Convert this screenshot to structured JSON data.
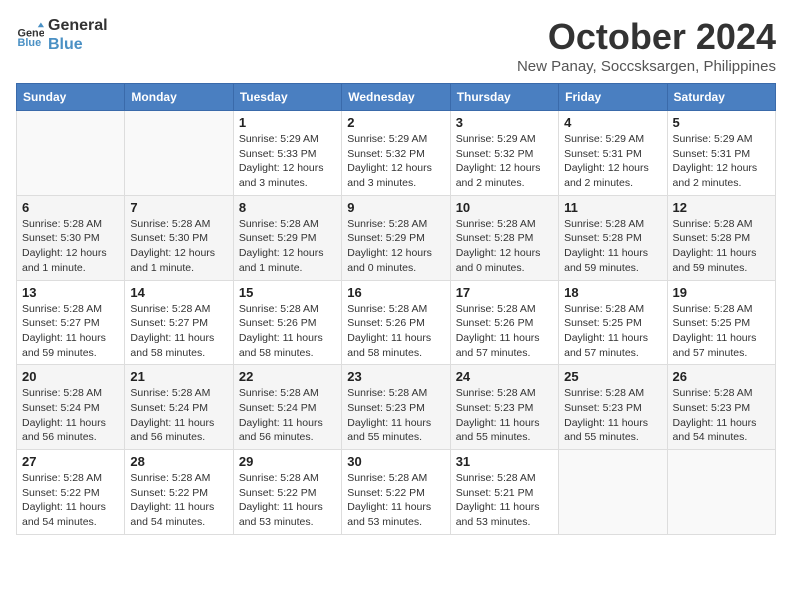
{
  "logo": {
    "line1": "General",
    "line2": "Blue"
  },
  "title": "October 2024",
  "subtitle": "New Panay, Soccsksargen, Philippines",
  "days_of_week": [
    "Sunday",
    "Monday",
    "Tuesday",
    "Wednesday",
    "Thursday",
    "Friday",
    "Saturday"
  ],
  "weeks": [
    [
      {
        "day": "",
        "info": ""
      },
      {
        "day": "",
        "info": ""
      },
      {
        "day": "1",
        "info": "Sunrise: 5:29 AM\nSunset: 5:33 PM\nDaylight: 12 hours\nand 3 minutes."
      },
      {
        "day": "2",
        "info": "Sunrise: 5:29 AM\nSunset: 5:32 PM\nDaylight: 12 hours\nand 3 minutes."
      },
      {
        "day": "3",
        "info": "Sunrise: 5:29 AM\nSunset: 5:32 PM\nDaylight: 12 hours\nand 2 minutes."
      },
      {
        "day": "4",
        "info": "Sunrise: 5:29 AM\nSunset: 5:31 PM\nDaylight: 12 hours\nand 2 minutes."
      },
      {
        "day": "5",
        "info": "Sunrise: 5:29 AM\nSunset: 5:31 PM\nDaylight: 12 hours\nand 2 minutes."
      }
    ],
    [
      {
        "day": "6",
        "info": "Sunrise: 5:28 AM\nSunset: 5:30 PM\nDaylight: 12 hours\nand 1 minute."
      },
      {
        "day": "7",
        "info": "Sunrise: 5:28 AM\nSunset: 5:30 PM\nDaylight: 12 hours\nand 1 minute."
      },
      {
        "day": "8",
        "info": "Sunrise: 5:28 AM\nSunset: 5:29 PM\nDaylight: 12 hours\nand 1 minute."
      },
      {
        "day": "9",
        "info": "Sunrise: 5:28 AM\nSunset: 5:29 PM\nDaylight: 12 hours\nand 0 minutes."
      },
      {
        "day": "10",
        "info": "Sunrise: 5:28 AM\nSunset: 5:28 PM\nDaylight: 12 hours\nand 0 minutes."
      },
      {
        "day": "11",
        "info": "Sunrise: 5:28 AM\nSunset: 5:28 PM\nDaylight: 11 hours\nand 59 minutes."
      },
      {
        "day": "12",
        "info": "Sunrise: 5:28 AM\nSunset: 5:28 PM\nDaylight: 11 hours\nand 59 minutes."
      }
    ],
    [
      {
        "day": "13",
        "info": "Sunrise: 5:28 AM\nSunset: 5:27 PM\nDaylight: 11 hours\nand 59 minutes."
      },
      {
        "day": "14",
        "info": "Sunrise: 5:28 AM\nSunset: 5:27 PM\nDaylight: 11 hours\nand 58 minutes."
      },
      {
        "day": "15",
        "info": "Sunrise: 5:28 AM\nSunset: 5:26 PM\nDaylight: 11 hours\nand 58 minutes."
      },
      {
        "day": "16",
        "info": "Sunrise: 5:28 AM\nSunset: 5:26 PM\nDaylight: 11 hours\nand 58 minutes."
      },
      {
        "day": "17",
        "info": "Sunrise: 5:28 AM\nSunset: 5:26 PM\nDaylight: 11 hours\nand 57 minutes."
      },
      {
        "day": "18",
        "info": "Sunrise: 5:28 AM\nSunset: 5:25 PM\nDaylight: 11 hours\nand 57 minutes."
      },
      {
        "day": "19",
        "info": "Sunrise: 5:28 AM\nSunset: 5:25 PM\nDaylight: 11 hours\nand 57 minutes."
      }
    ],
    [
      {
        "day": "20",
        "info": "Sunrise: 5:28 AM\nSunset: 5:24 PM\nDaylight: 11 hours\nand 56 minutes."
      },
      {
        "day": "21",
        "info": "Sunrise: 5:28 AM\nSunset: 5:24 PM\nDaylight: 11 hours\nand 56 minutes."
      },
      {
        "day": "22",
        "info": "Sunrise: 5:28 AM\nSunset: 5:24 PM\nDaylight: 11 hours\nand 56 minutes."
      },
      {
        "day": "23",
        "info": "Sunrise: 5:28 AM\nSunset: 5:23 PM\nDaylight: 11 hours\nand 55 minutes."
      },
      {
        "day": "24",
        "info": "Sunrise: 5:28 AM\nSunset: 5:23 PM\nDaylight: 11 hours\nand 55 minutes."
      },
      {
        "day": "25",
        "info": "Sunrise: 5:28 AM\nSunset: 5:23 PM\nDaylight: 11 hours\nand 55 minutes."
      },
      {
        "day": "26",
        "info": "Sunrise: 5:28 AM\nSunset: 5:23 PM\nDaylight: 11 hours\nand 54 minutes."
      }
    ],
    [
      {
        "day": "27",
        "info": "Sunrise: 5:28 AM\nSunset: 5:22 PM\nDaylight: 11 hours\nand 54 minutes."
      },
      {
        "day": "28",
        "info": "Sunrise: 5:28 AM\nSunset: 5:22 PM\nDaylight: 11 hours\nand 54 minutes."
      },
      {
        "day": "29",
        "info": "Sunrise: 5:28 AM\nSunset: 5:22 PM\nDaylight: 11 hours\nand 53 minutes."
      },
      {
        "day": "30",
        "info": "Sunrise: 5:28 AM\nSunset: 5:22 PM\nDaylight: 11 hours\nand 53 minutes."
      },
      {
        "day": "31",
        "info": "Sunrise: 5:28 AM\nSunset: 5:21 PM\nDaylight: 11 hours\nand 53 minutes."
      },
      {
        "day": "",
        "info": ""
      },
      {
        "day": "",
        "info": ""
      }
    ]
  ]
}
